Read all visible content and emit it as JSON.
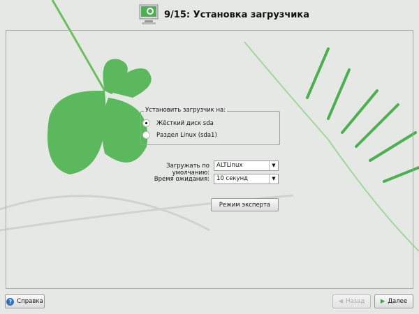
{
  "header": {
    "title": "9/15: Установка загрузчика",
    "icon": "monitor-settings-icon"
  },
  "bootloader_group": {
    "title": "Установить загрузчик на:",
    "options": [
      {
        "label": "Жёсткий диск sda",
        "selected": true
      },
      {
        "label": "Раздел Linux (sda1)",
        "selected": false
      }
    ]
  },
  "default_boot": {
    "label": "Загружать по умолчанию:",
    "value": "ALTLinux"
  },
  "timeout": {
    "label": "Время ожидания:",
    "value": "10 секунд"
  },
  "expert_button": "Режим эксперта",
  "footer": {
    "help": "Справка",
    "back": "Назад",
    "next": "Далее"
  },
  "colors": {
    "accent": "#5cb85c"
  }
}
